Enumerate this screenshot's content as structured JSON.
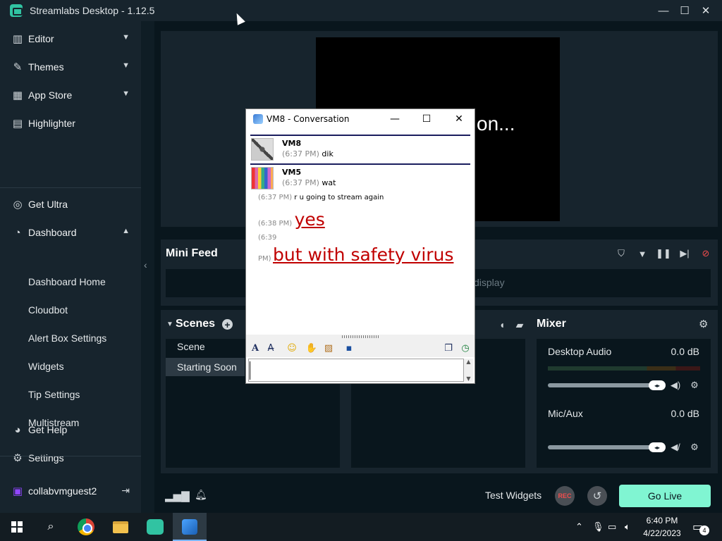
{
  "window": {
    "title": "Streamlabs Desktop - 1.12.5",
    "minimize_icon": "minimize-icon",
    "maximize_icon": "maximize-icon",
    "close_icon": "close-icon"
  },
  "sidebar": {
    "top_items": [
      {
        "label": "Editor",
        "icon": "editor-icon",
        "expandable": true
      },
      {
        "label": "Themes",
        "icon": "themes-icon",
        "expandable": true
      },
      {
        "label": "App Store",
        "icon": "store-icon",
        "expandable": true
      },
      {
        "label": "Highlighter",
        "icon": "highlighter-icon",
        "expandable": false
      }
    ],
    "get_ultra": "Get Ultra",
    "dashboard": {
      "label": "Dashboard",
      "expanded": true,
      "children": [
        "Dashboard Home",
        "Cloudbot",
        "Alert Box Settings",
        "Widgets",
        "Tip Settings",
        "Multistream"
      ]
    },
    "get_help": "Get Help",
    "settings": "Settings",
    "user": {
      "name": "collabvmguest2",
      "logout_icon": "logout-icon"
    }
  },
  "editor": {
    "preview_text": "on..."
  },
  "mini_feed": {
    "title": "Mini Feed",
    "empty_text": "display",
    "controls": [
      "shield-icon",
      "filter-icon",
      "pause-icon",
      "skip-icon",
      "mute-alerts-icon"
    ]
  },
  "scenes": {
    "title": "Scenes",
    "items": [
      {
        "label": "Scene",
        "selected": false
      },
      {
        "label": "Starting Soon",
        "selected": true
      }
    ]
  },
  "mixer": {
    "title": "Mixer",
    "channels": [
      {
        "name": "Desktop Audio",
        "level": "0.0 dB",
        "muted": false
      },
      {
        "name": "Mic/Aux",
        "level": "0.0 dB",
        "muted": true
      }
    ]
  },
  "footer": {
    "test_widgets": "Test Widgets",
    "rec_label": "REC",
    "go_live": "Go Live"
  },
  "conversation": {
    "title": "VM8 - Conversation",
    "messages": [
      {
        "user": "VM8",
        "time": "(6:37 PM)",
        "text": "dik"
      },
      {
        "user": "VM5",
        "time": "(6:37 PM)",
        "text": "wat"
      },
      {
        "user": "",
        "time": "(6:37 PM)",
        "text": "r u going to stream again"
      },
      {
        "user": "",
        "time": "(6:38 PM)",
        "text": "yes"
      },
      {
        "user": "",
        "time_top": "(6:39",
        "time_bottom": "PM)",
        "text": "but with safety virus"
      }
    ],
    "text_color": "#c00000"
  },
  "taskbar": {
    "time": "6:40 PM",
    "date": "4/22/2023",
    "notifications": "4"
  }
}
